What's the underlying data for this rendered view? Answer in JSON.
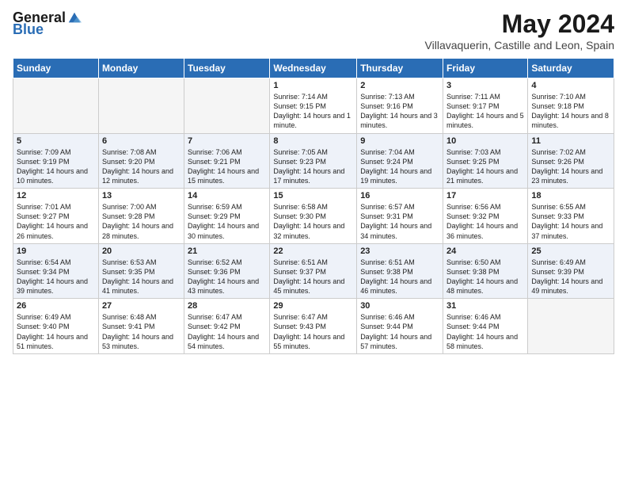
{
  "header": {
    "logo_general": "General",
    "logo_blue": "Blue",
    "title": "May 2024",
    "subtitle": "Villavaquerin, Castille and Leon, Spain"
  },
  "weekdays": [
    "Sunday",
    "Monday",
    "Tuesday",
    "Wednesday",
    "Thursday",
    "Friday",
    "Saturday"
  ],
  "weeks": [
    [
      {
        "day": "",
        "empty": true
      },
      {
        "day": "",
        "empty": true
      },
      {
        "day": "",
        "empty": true
      },
      {
        "day": "1",
        "sunrise": "7:14 AM",
        "sunset": "9:15 PM",
        "daylight": "14 hours and 1 minute."
      },
      {
        "day": "2",
        "sunrise": "7:13 AM",
        "sunset": "9:16 PM",
        "daylight": "14 hours and 3 minutes."
      },
      {
        "day": "3",
        "sunrise": "7:11 AM",
        "sunset": "9:17 PM",
        "daylight": "14 hours and 5 minutes."
      },
      {
        "day": "4",
        "sunrise": "7:10 AM",
        "sunset": "9:18 PM",
        "daylight": "14 hours and 8 minutes."
      }
    ],
    [
      {
        "day": "5",
        "sunrise": "7:09 AM",
        "sunset": "9:19 PM",
        "daylight": "14 hours and 10 minutes."
      },
      {
        "day": "6",
        "sunrise": "7:08 AM",
        "sunset": "9:20 PM",
        "daylight": "14 hours and 12 minutes."
      },
      {
        "day": "7",
        "sunrise": "7:06 AM",
        "sunset": "9:21 PM",
        "daylight": "14 hours and 15 minutes."
      },
      {
        "day": "8",
        "sunrise": "7:05 AM",
        "sunset": "9:23 PM",
        "daylight": "14 hours and 17 minutes."
      },
      {
        "day": "9",
        "sunrise": "7:04 AM",
        "sunset": "9:24 PM",
        "daylight": "14 hours and 19 minutes."
      },
      {
        "day": "10",
        "sunrise": "7:03 AM",
        "sunset": "9:25 PM",
        "daylight": "14 hours and 21 minutes."
      },
      {
        "day": "11",
        "sunrise": "7:02 AM",
        "sunset": "9:26 PM",
        "daylight": "14 hours and 23 minutes."
      }
    ],
    [
      {
        "day": "12",
        "sunrise": "7:01 AM",
        "sunset": "9:27 PM",
        "daylight": "14 hours and 26 minutes."
      },
      {
        "day": "13",
        "sunrise": "7:00 AM",
        "sunset": "9:28 PM",
        "daylight": "14 hours and 28 minutes."
      },
      {
        "day": "14",
        "sunrise": "6:59 AM",
        "sunset": "9:29 PM",
        "daylight": "14 hours and 30 minutes."
      },
      {
        "day": "15",
        "sunrise": "6:58 AM",
        "sunset": "9:30 PM",
        "daylight": "14 hours and 32 minutes."
      },
      {
        "day": "16",
        "sunrise": "6:57 AM",
        "sunset": "9:31 PM",
        "daylight": "14 hours and 34 minutes."
      },
      {
        "day": "17",
        "sunrise": "6:56 AM",
        "sunset": "9:32 PM",
        "daylight": "14 hours and 36 minutes."
      },
      {
        "day": "18",
        "sunrise": "6:55 AM",
        "sunset": "9:33 PM",
        "daylight": "14 hours and 37 minutes."
      }
    ],
    [
      {
        "day": "19",
        "sunrise": "6:54 AM",
        "sunset": "9:34 PM",
        "daylight": "14 hours and 39 minutes."
      },
      {
        "day": "20",
        "sunrise": "6:53 AM",
        "sunset": "9:35 PM",
        "daylight": "14 hours and 41 minutes."
      },
      {
        "day": "21",
        "sunrise": "6:52 AM",
        "sunset": "9:36 PM",
        "daylight": "14 hours and 43 minutes."
      },
      {
        "day": "22",
        "sunrise": "6:51 AM",
        "sunset": "9:37 PM",
        "daylight": "14 hours and 45 minutes."
      },
      {
        "day": "23",
        "sunrise": "6:51 AM",
        "sunset": "9:38 PM",
        "daylight": "14 hours and 46 minutes."
      },
      {
        "day": "24",
        "sunrise": "6:50 AM",
        "sunset": "9:38 PM",
        "daylight": "14 hours and 48 minutes."
      },
      {
        "day": "25",
        "sunrise": "6:49 AM",
        "sunset": "9:39 PM",
        "daylight": "14 hours and 49 minutes."
      }
    ],
    [
      {
        "day": "26",
        "sunrise": "6:49 AM",
        "sunset": "9:40 PM",
        "daylight": "14 hours and 51 minutes."
      },
      {
        "day": "27",
        "sunrise": "6:48 AM",
        "sunset": "9:41 PM",
        "daylight": "14 hours and 53 minutes."
      },
      {
        "day": "28",
        "sunrise": "6:47 AM",
        "sunset": "9:42 PM",
        "daylight": "14 hours and 54 minutes."
      },
      {
        "day": "29",
        "sunrise": "6:47 AM",
        "sunset": "9:43 PM",
        "daylight": "14 hours and 55 minutes."
      },
      {
        "day": "30",
        "sunrise": "6:46 AM",
        "sunset": "9:44 PM",
        "daylight": "14 hours and 57 minutes."
      },
      {
        "day": "31",
        "sunrise": "6:46 AM",
        "sunset": "9:44 PM",
        "daylight": "14 hours and 58 minutes."
      },
      {
        "day": "",
        "empty": true
      }
    ]
  ]
}
